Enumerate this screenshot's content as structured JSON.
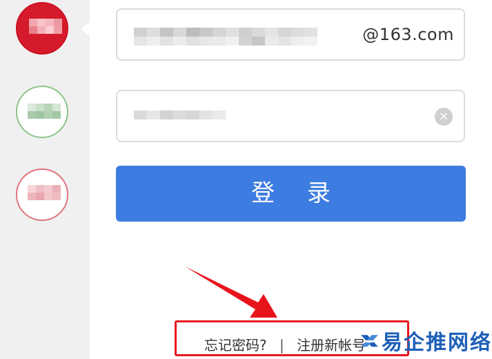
{
  "accounts": [
    {
      "state": "active",
      "color": "#d51b2b"
    },
    {
      "state": "inactive",
      "color": "#8cc48c"
    },
    {
      "state": "inactive",
      "color": "#e0737c"
    }
  ],
  "login_form": {
    "username_suffix": "@163.com",
    "login_label": "登 录",
    "clear_icon": "×"
  },
  "links": {
    "forgot_password": "忘记密码?",
    "separator": "|",
    "register": "注册新帐号"
  },
  "watermark": {
    "text": "易企推网络"
  },
  "colors": {
    "primary_button": "#3d7ce0",
    "annotation_red": "#e8141c",
    "watermark_blue": "#1d5fb8"
  }
}
